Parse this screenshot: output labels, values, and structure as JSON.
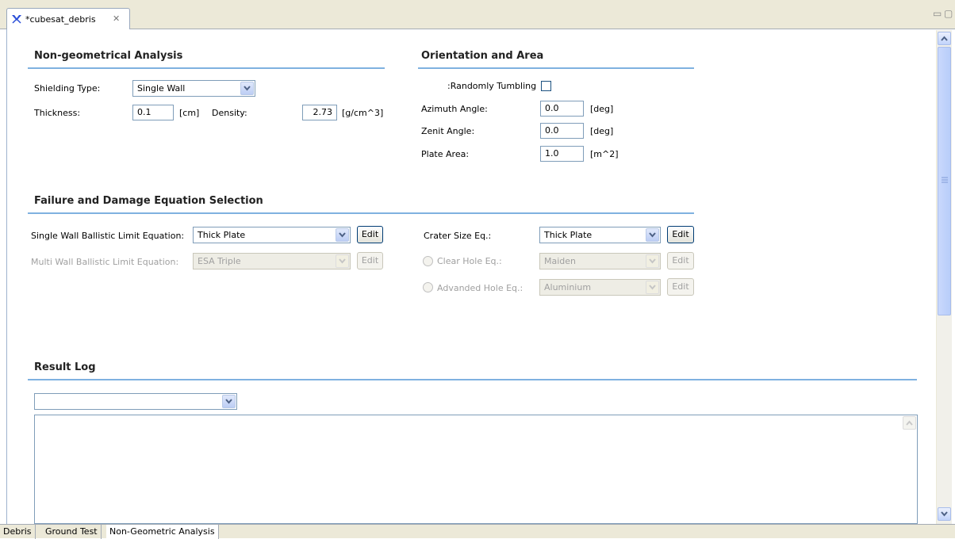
{
  "editor_tab": {
    "title": "*cubesat_debris",
    "close": "✕",
    "icon": "eclipse-plugin-icon"
  },
  "window_controls": {
    "minimize": "▭",
    "maximize": "▢"
  },
  "non_geometrical": {
    "title": "Non-geometrical Analysis",
    "shielding_type_label": "Shielding Type:",
    "shielding_type_value": "Single Wall",
    "thickness_label": "Thickness:",
    "thickness_value": "0.1",
    "thickness_unit": "[cm]",
    "density_label": "Density:",
    "density_value": "2.73",
    "density_unit": "[g/cm^3]"
  },
  "orientation": {
    "title": "Orientation and Area",
    "tumbling_label": ":Randomly Tumbling",
    "tumbling_checked": false,
    "azimuth_label": "Azimuth Angle:",
    "azimuth_value": "0.0",
    "azimuth_unit": "[deg]",
    "zenit_label": "Zenit Angle:",
    "zenit_value": "0.0",
    "zenit_unit": "[deg]",
    "plate_label": "Plate Area:",
    "plate_value": "1.0",
    "plate_unit": "[m^2]"
  },
  "failure": {
    "title": "Failure and Damage Equation Selection",
    "single_wall_label": "Single Wall Ballistic Limit Equation:",
    "single_wall_value": "Thick Plate",
    "multi_wall_label": "Multi Wall Ballistic Limit Equation:",
    "multi_wall_value": "ESA Triple",
    "crater_label": "Crater Size Eq.:",
    "crater_value": "Thick Plate",
    "clear_hole_label": "Clear Hole Eq.:",
    "clear_hole_value": "Maiden",
    "advanded_hole_label": "Advanded Hole Eq.:",
    "advanded_hole_value": "Aluminium",
    "edit_label": "Edit"
  },
  "result_log": {
    "title": "Result Log",
    "selector_value": "",
    "text": ""
  },
  "bottom_tabs": [
    "Debris",
    "Ground Test",
    "Non-Geometric Analysis"
  ],
  "colors": {
    "section_rule": "#7fb1e0",
    "tab_bar": "#ece9d8",
    "input_border": "#7f9db9"
  }
}
